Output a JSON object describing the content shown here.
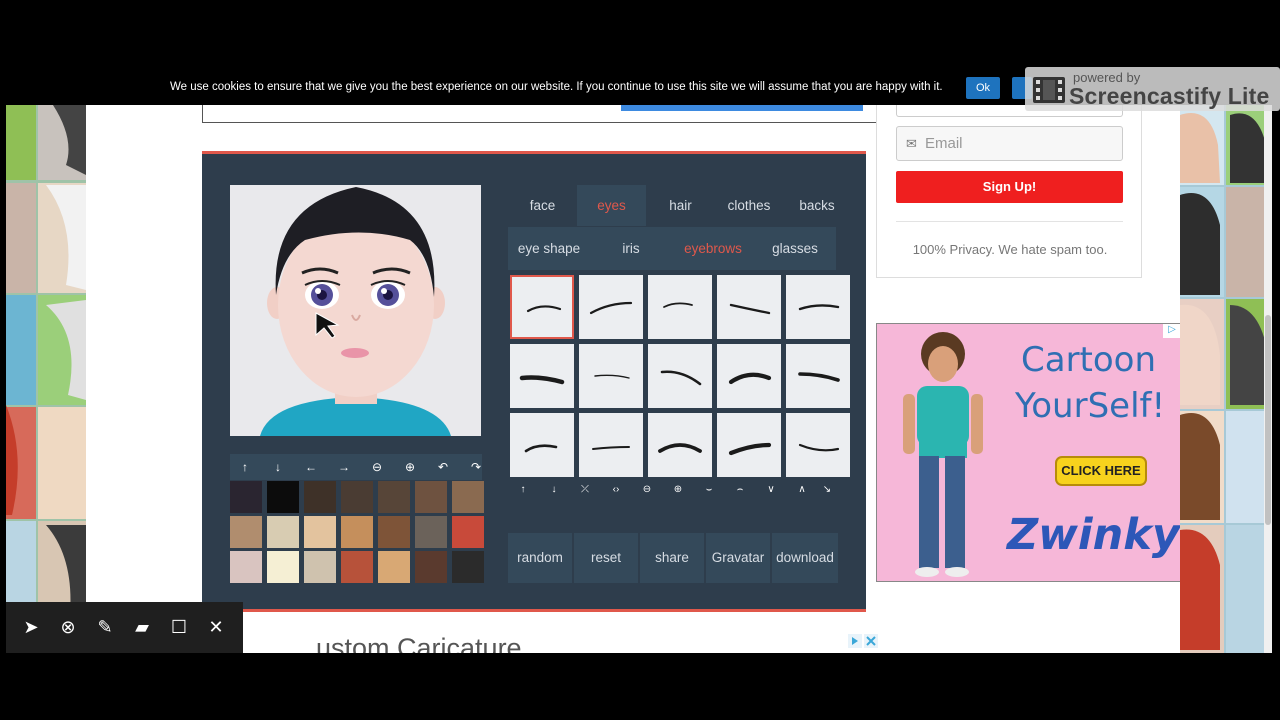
{
  "cookie_bar": {
    "text": "We use cookies to ensure that we give you the best experience on our website. If you continue to use this site we will assume that you are happy with it.",
    "ok_label": "Ok"
  },
  "watermark": {
    "powered_by": "powered by",
    "title": "Screencastify Lite"
  },
  "editor": {
    "tabs": [
      {
        "label": "face"
      },
      {
        "label": "eyes"
      },
      {
        "label": "hair"
      },
      {
        "label": "clothes"
      },
      {
        "label": "backs"
      }
    ],
    "active_tab": "eyes",
    "subtabs": [
      {
        "label": "eye shape"
      },
      {
        "label": "iris"
      },
      {
        "label": "eyebrows"
      },
      {
        "label": "glasses"
      }
    ],
    "active_subtab": "eyebrows",
    "preview_tools": [
      "arrow-up-icon",
      "arrow-down-icon",
      "arrow-left-icon",
      "arrow-right-icon",
      "zoom-out-icon",
      "zoom-in-icon",
      "undo-icon",
      "redo-icon"
    ],
    "grid_tools": [
      "move-up-icon",
      "move-down-icon",
      "narrow-icon",
      "widen-icon",
      "shrink-icon",
      "enlarge-icon",
      "tilt-in-icon",
      "tilt-out-icon",
      "raise-icon",
      "lower-icon",
      "rotate-icon"
    ],
    "actions": [
      {
        "label": "random"
      },
      {
        "label": "reset"
      },
      {
        "label": "share"
      },
      {
        "label": "Gravatar"
      },
      {
        "label": "download"
      }
    ],
    "swatch_colors": [
      "#2a2530",
      "#0c0c0c",
      "#3e3128",
      "#4a3c33",
      "#574538",
      "#6e5240",
      "#8a6a50",
      "#b08d6e",
      "#d8ccb2",
      "#e3c39e",
      "#c58f5c",
      "#7e5438",
      "#6b625a",
      "#c84a3a",
      "#d9c4c0",
      "#f5efd4",
      "#cfc2ae",
      "#b7523a",
      "#d8a874",
      "#5a3a2e",
      "#2b2b2b"
    ],
    "accent_color": "#e0584b"
  },
  "bottom": {
    "heading": "ustom Caricature"
  },
  "sidebar": {
    "email_placeholder": "Email",
    "signup_label": "Sign Up!",
    "privacy_text": "100% Privacy. We hate spam too."
  },
  "ad": {
    "title_line1": "Cartoon",
    "title_line2": "YourSelf!",
    "cta": "CLICK HERE",
    "brand": "Zwinky"
  }
}
